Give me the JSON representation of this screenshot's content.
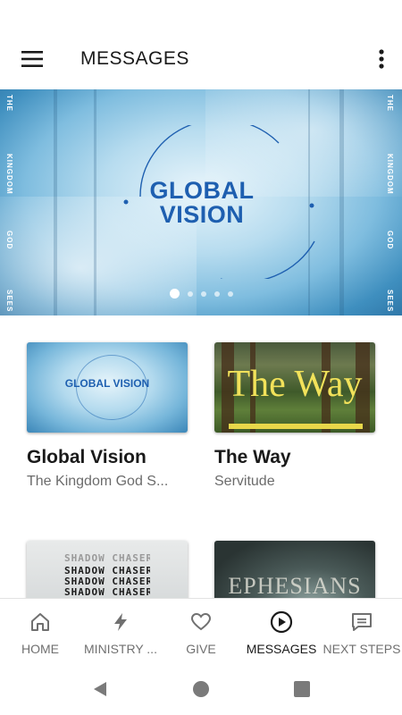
{
  "app_bar": {
    "title": "MESSAGES",
    "menu_icon": "hamburger-menu-icon",
    "more_icon": "more-vertical-icon"
  },
  "hero": {
    "title_line1": "GLOBAL",
    "title_line2": "VISION",
    "left_words": [
      "THE",
      "KINGDOM",
      "GOD",
      "SEES"
    ],
    "right_words": [
      "THE",
      "KINGDOM",
      "GOD",
      "SEES"
    ],
    "carousel_pages": 5,
    "active_page": 1,
    "accent": "#1e5fb0"
  },
  "cards": [
    {
      "title": "Global Vision",
      "subtitle": "The Kingdom God S...",
      "thumb_text": "GLOBAL VISION"
    },
    {
      "title": "The Way",
      "subtitle": "Servitude",
      "thumb_text": "The Way"
    },
    {
      "title": "",
      "subtitle": "",
      "thumb_text": "SHADOW CHASERS"
    },
    {
      "title": "",
      "subtitle": "",
      "thumb_text": "EPHESIANS"
    }
  ],
  "bottom_nav": [
    {
      "label": "HOME",
      "icon": "home-icon"
    },
    {
      "label": "MINISTRY ...",
      "icon": "lightning-icon"
    },
    {
      "label": "GIVE",
      "icon": "heart-icon"
    },
    {
      "label": "MESSAGES",
      "icon": "play-circle-icon",
      "active": true
    },
    {
      "label": "NEXT STEPS",
      "icon": "message-square-icon"
    }
  ],
  "system_nav": [
    "back-icon",
    "home-circle-icon",
    "recents-icon"
  ]
}
